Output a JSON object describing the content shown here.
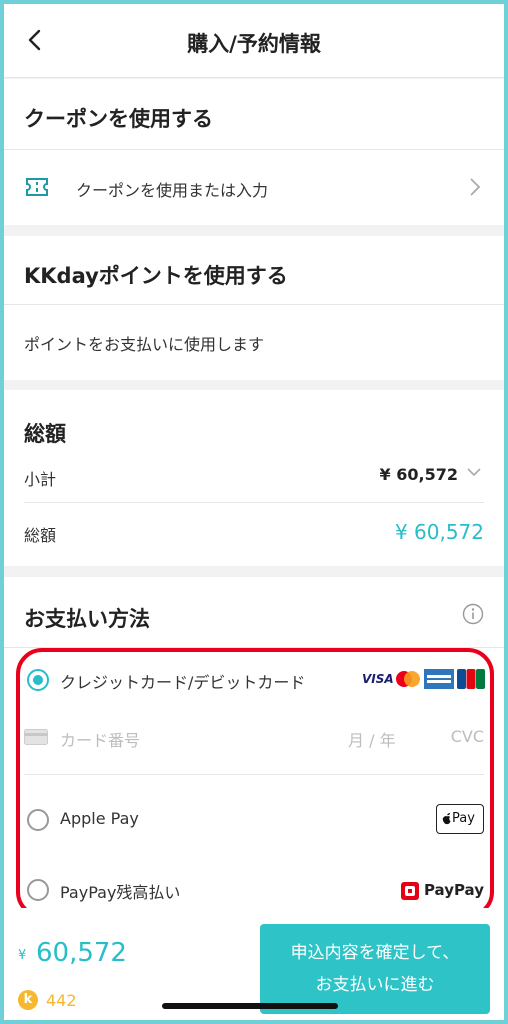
{
  "header": {
    "title": "購入/予約情報"
  },
  "coupon": {
    "title": "クーポンを使用する",
    "row_label": "クーポンを使用または入力"
  },
  "points": {
    "title": "KKdayポイントを使用する",
    "row_label": "ポイントをお支払いに使用します"
  },
  "total": {
    "title": "総額",
    "subtotal_label": "小計",
    "subtotal_value": "¥ 60,572",
    "total_label": "総額",
    "total_value": "¥ 60,572"
  },
  "payment": {
    "title": "お支払い方法",
    "options": [
      {
        "label": "クレジットカード/デビットカード",
        "selected": true
      },
      {
        "label": "Apple Pay",
        "selected": false
      },
      {
        "label": "PayPay残高払い",
        "selected": false
      }
    ],
    "card_number_placeholder": "カード番号",
    "expiry_placeholder": "月 / 年",
    "cvc_placeholder": "CVC",
    "card_brands": [
      "VISA",
      "mastercard",
      "AMERICAN EXPRESS",
      "JCB"
    ],
    "apple_pay_badge": "Pay",
    "paypay_badge": "PayPay"
  },
  "footer": {
    "currency": "¥",
    "amount": "60,572",
    "points": "442",
    "points_icon_letter": "k",
    "cta_line1": "申込内容を確定して、",
    "cta_line2": "お支払いに進む"
  },
  "colors": {
    "accent": "#26bec9",
    "highlight": "#e8001c",
    "cta": "#2ec3c7"
  }
}
